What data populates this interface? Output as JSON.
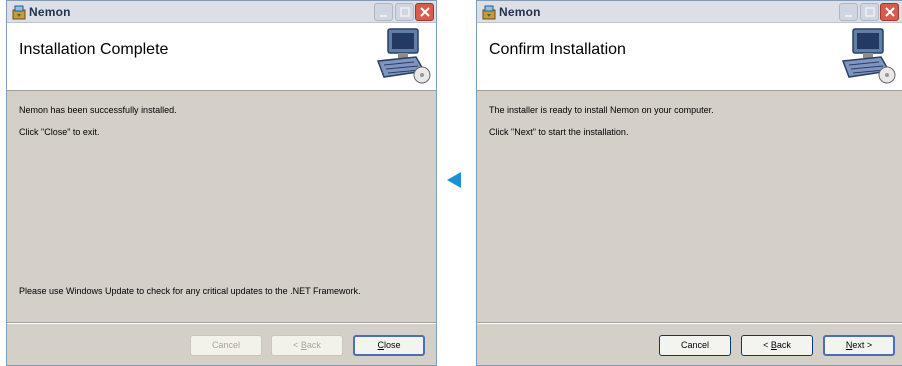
{
  "left_window": {
    "title": "Nemon",
    "banner_title": "Installation Complete",
    "line1": "Nemon has been successfully installed.",
    "line2": "Click \"Close\" to exit.",
    "line3": "Please use Windows Update to check for any critical updates to the .NET Framework.",
    "buttons": {
      "cancel": "Cancel",
      "back_prefix": "< ",
      "back_mn": "B",
      "back_rest": "ack",
      "close_mn": "C",
      "close_rest": "lose"
    },
    "states": {
      "cancel": "disabled",
      "back": "disabled",
      "close": "default"
    }
  },
  "right_window": {
    "title": "Nemon",
    "banner_title": "Confirm Installation",
    "line1": "The installer is ready to install Nemon on your computer.",
    "line2": "Click \"Next\" to start the installation.",
    "buttons": {
      "cancel": "Cancel",
      "back_prefix": "< ",
      "back_mn": "B",
      "back_rest": "ack",
      "next_mn": "N",
      "next_rest": "ext >"
    },
    "states": {
      "cancel": "enabled",
      "back": "enabled",
      "next": "default"
    }
  },
  "icons": {
    "app": "installer-app-icon",
    "banner": "computer-setup-icon",
    "arrow": "left-arrow-icon",
    "minimize": "minimize-icon",
    "maximize": "maximize-icon",
    "close": "close-icon"
  },
  "colors": {
    "arrow": "#1a8fd8",
    "dialog_bg": "#d4d0c8",
    "banner_bg": "#ffffff",
    "close_button": "#d75b4f"
  }
}
